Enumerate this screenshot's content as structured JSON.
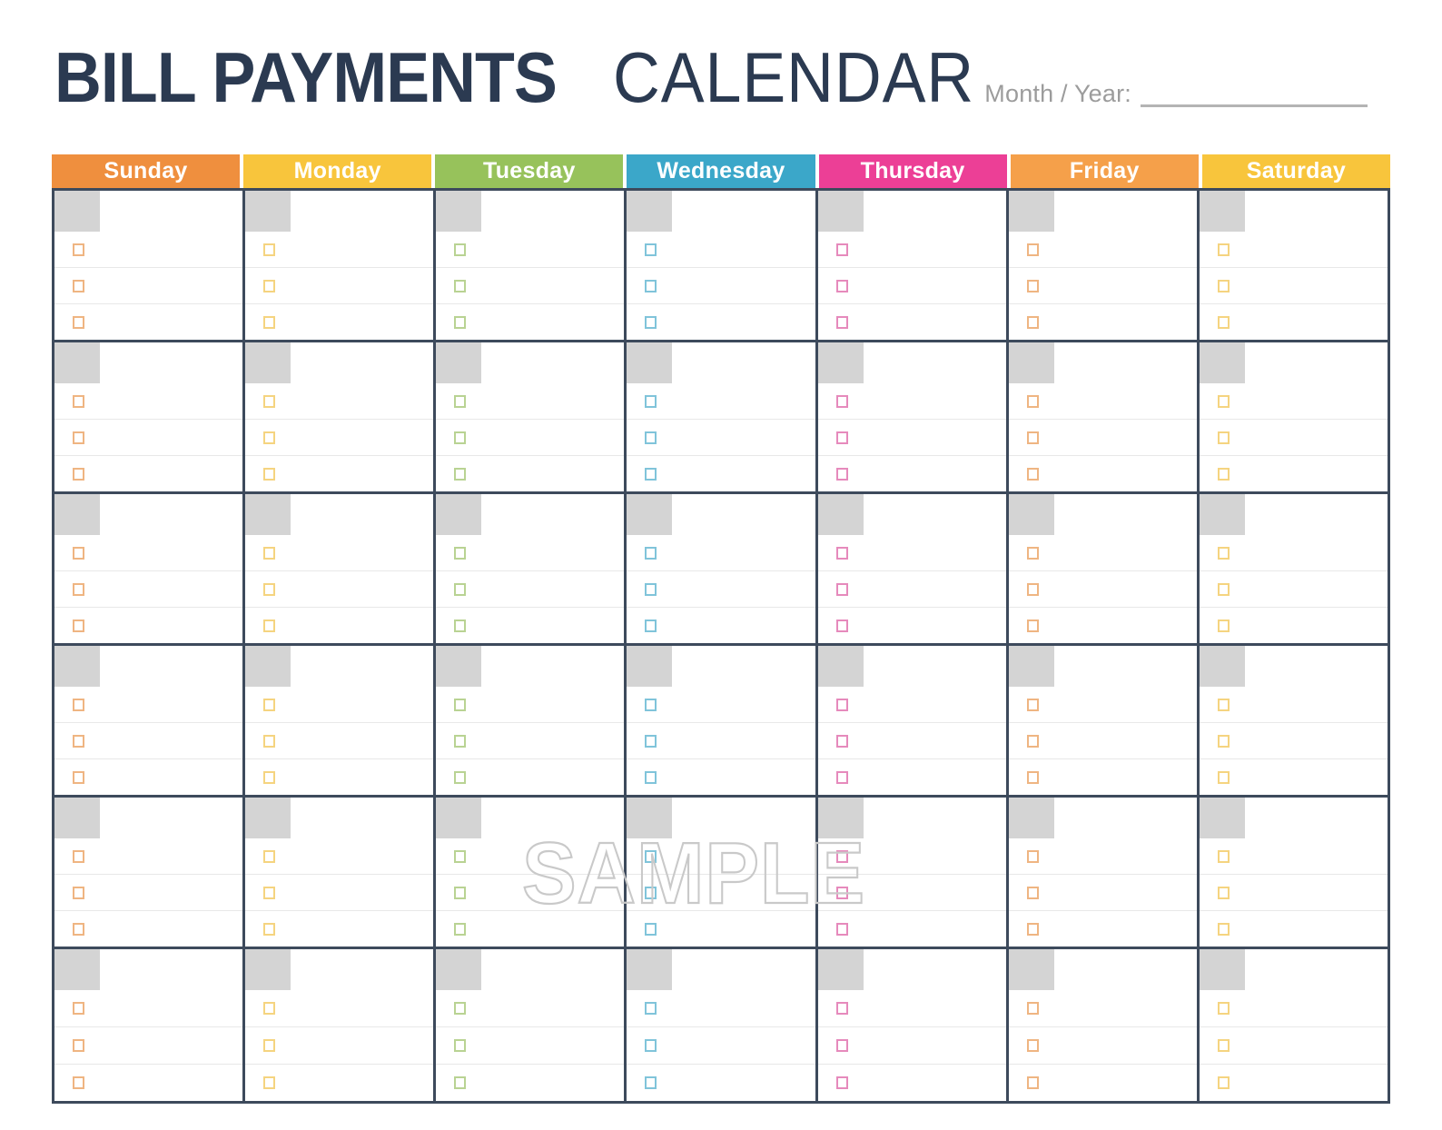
{
  "header": {
    "title_bold": "BILL PAYMENTS",
    "title_light": "CALENDAR",
    "month_year_label": "Month / Year:",
    "month_year_value": "",
    "title_color": "#2b3a51",
    "label_color": "#9c9c9c"
  },
  "watermark": {
    "text": "SAMPLE",
    "color": "#c9c9c9"
  },
  "calendar": {
    "grid_border_color": "#3d4a5c",
    "date_box_color": "#d4d4d4",
    "row_divider_color": "#e8e8e8",
    "weeks_count": 6,
    "task_lines_per_day": 3,
    "columns": [
      {
        "label": "Sunday",
        "header_color": "#ef8f3e",
        "checkbox_color": "#efb582"
      },
      {
        "label": "Monday",
        "header_color": "#f8c53c",
        "checkbox_color": "#f5d480"
      },
      {
        "label": "Tuesday",
        "header_color": "#97c25b",
        "checkbox_color": "#b9d393"
      },
      {
        "label": "Wednesday",
        "header_color": "#3ba7c9",
        "checkbox_color": "#80c4da"
      },
      {
        "label": "Thursday",
        "header_color": "#ec3f96",
        "checkbox_color": "#e68abc"
      },
      {
        "label": "Friday",
        "header_color": "#f5a04a",
        "checkbox_color": "#efb582"
      },
      {
        "label": "Saturday",
        "header_color": "#f8c53c",
        "checkbox_color": "#f5d480"
      }
    ]
  }
}
